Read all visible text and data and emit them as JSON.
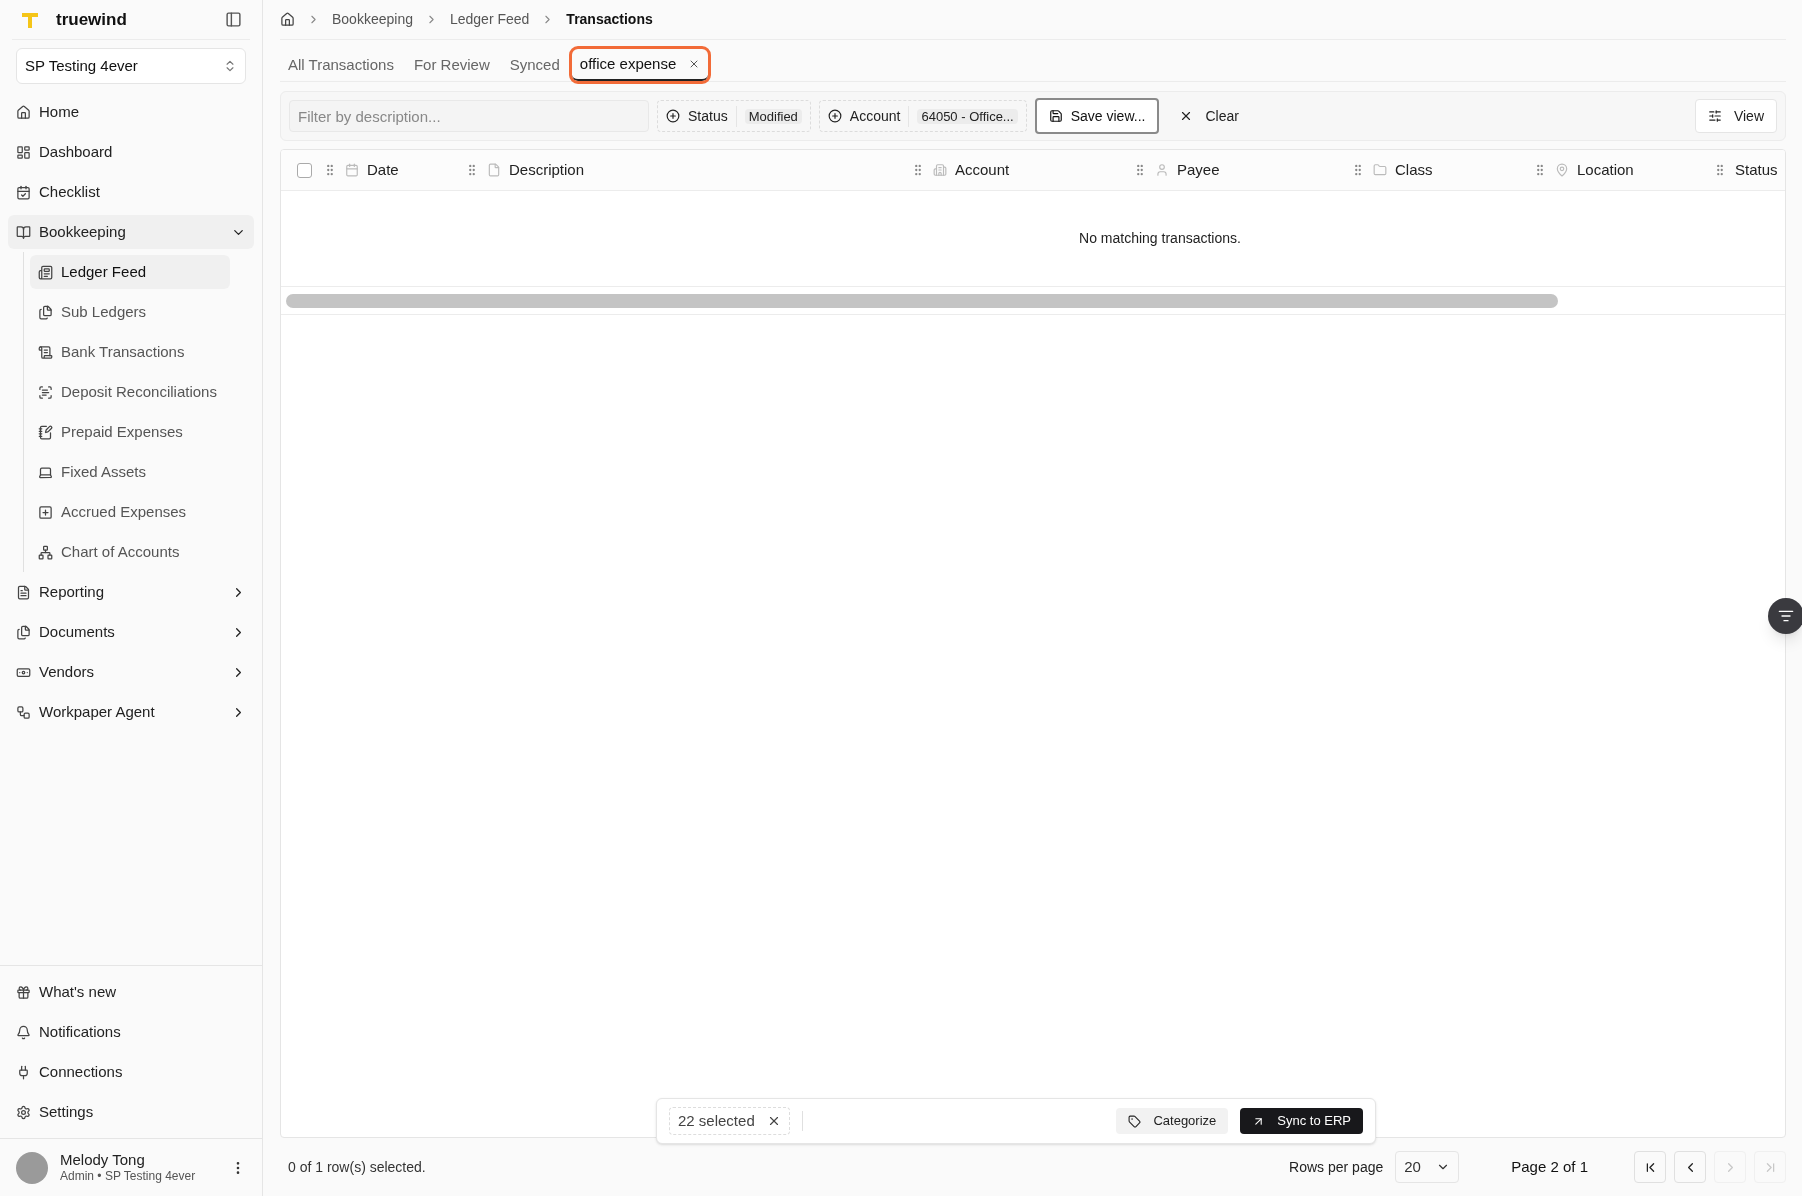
{
  "sidebar": {
    "brand": "truewind",
    "org_select": "SP Testing 4ever",
    "items": [
      {
        "label": "Home"
      },
      {
        "label": "Dashboard"
      },
      {
        "label": "Checklist"
      },
      {
        "label": "Bookkeeping",
        "expanded": true,
        "children": [
          {
            "label": "Ledger Feed",
            "selected": true
          },
          {
            "label": "Sub Ledgers",
            "selected": false
          },
          {
            "label": "Bank Transactions",
            "selected": false
          },
          {
            "label": "Deposit Reconciliations",
            "selected": false
          },
          {
            "label": "Prepaid Expenses",
            "selected": false
          },
          {
            "label": "Fixed Assets",
            "selected": false
          },
          {
            "label": "Accrued Expenses",
            "selected": false
          },
          {
            "label": "Chart of Accounts",
            "selected": false
          }
        ]
      },
      {
        "label": "Reporting",
        "expanded": false
      },
      {
        "label": "Documents",
        "expanded": false
      },
      {
        "label": "Vendors",
        "expanded": false
      },
      {
        "label": "Workpaper Agent",
        "expanded": false
      }
    ],
    "footer_items": [
      {
        "label": "What's new"
      },
      {
        "label": "Notifications"
      },
      {
        "label": "Connections"
      },
      {
        "label": "Settings"
      }
    ],
    "user": {
      "name": "Melody Tong",
      "subtitle": "Admin • SP Testing 4ever"
    }
  },
  "breadcrumb": [
    "Bookkeeping",
    "Ledger Feed",
    "Transactions"
  ],
  "tabs": [
    {
      "label": "All Transactions",
      "selected": false,
      "closable": false
    },
    {
      "label": "For Review",
      "selected": false,
      "closable": false
    },
    {
      "label": "Synced",
      "selected": false,
      "closable": false
    },
    {
      "label": "office expense",
      "selected": true,
      "closable": true
    }
  ],
  "toolbar": {
    "filter_placeholder": "Filter by description...",
    "filters": [
      {
        "label": "Status",
        "value": "Modified"
      },
      {
        "label": "Account",
        "value": "64050 - Office..."
      }
    ],
    "save_view": "Save view...",
    "clear": "Clear",
    "view": "View"
  },
  "table": {
    "columns": [
      "Date",
      "Description",
      "Account",
      "Payee",
      "Class",
      "Location",
      "Status"
    ],
    "all_checked": false,
    "empty_message": "No matching transactions."
  },
  "footer": {
    "selection": "0 of 1 row(s) selected.",
    "rows_per_page_label": "Rows per page",
    "rows_per_page": "20",
    "page": "Page 2 of 1",
    "pager": [
      {
        "disabled": false
      },
      {
        "disabled": false
      },
      {
        "disabled": true
      },
      {
        "disabled": true
      }
    ]
  },
  "bulk_bar": {
    "count": "22 selected",
    "categorize": "Categorize",
    "sync": "Sync to ERP"
  }
}
